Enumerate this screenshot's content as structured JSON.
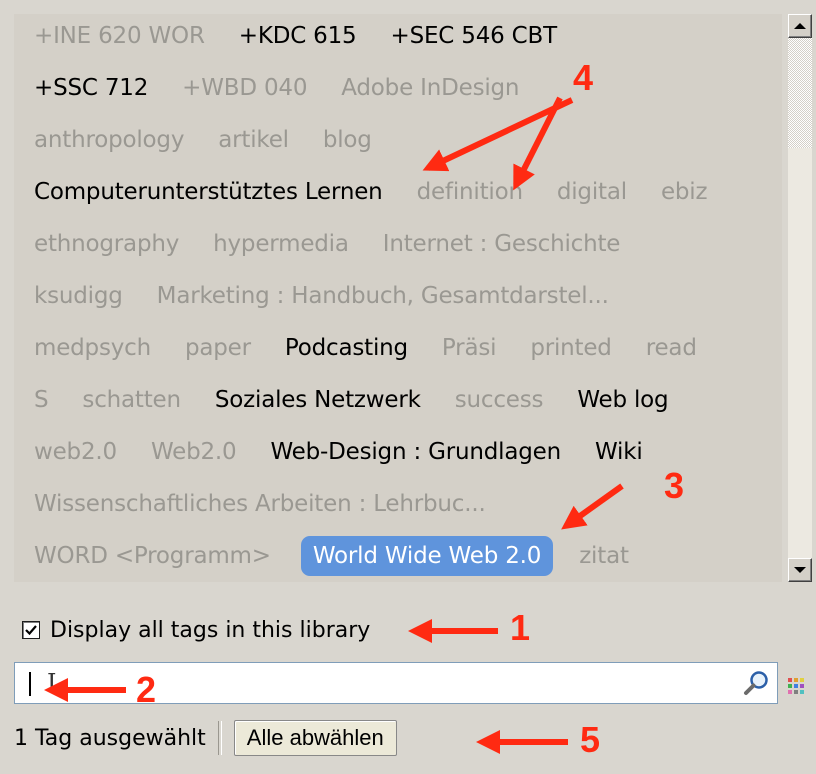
{
  "tags": {
    "rows": [
      [
        {
          "text": "+INE 620 WOR",
          "style": "dim"
        },
        {
          "text": "+KDC 615",
          "style": "bold"
        },
        {
          "text": "+SEC 546 CBT",
          "style": "bold"
        }
      ],
      [
        {
          "text": "+SSC 712",
          "style": "bold"
        },
        {
          "text": "+WBD 040",
          "style": "dim"
        },
        {
          "text": "Adobe InDesign",
          "style": "dim"
        }
      ],
      [
        {
          "text": "anthropology",
          "style": "dim"
        },
        {
          "text": "artikel",
          "style": "dim"
        },
        {
          "text": "blog",
          "style": "dim"
        }
      ],
      [
        {
          "text": "Computerunterstütztes Lernen",
          "style": "bold"
        },
        {
          "text": "definition",
          "style": "dim"
        },
        {
          "text": "digital",
          "style": "dim"
        },
        {
          "text": "ebiz",
          "style": "dim"
        }
      ],
      [
        {
          "text": "ethnography",
          "style": "dim"
        },
        {
          "text": "hypermedia",
          "style": "dim"
        },
        {
          "text": "Internet : Geschichte",
          "style": "dim"
        }
      ],
      [
        {
          "text": "ksudigg",
          "style": "dim"
        },
        {
          "text": "Marketing : Handbuch, Gesamtdarstel...",
          "style": "dim"
        }
      ],
      [
        {
          "text": "medpsych",
          "style": "dim"
        },
        {
          "text": "paper",
          "style": "dim"
        },
        {
          "text": "Podcasting",
          "style": "bold"
        },
        {
          "text": "Präsi",
          "style": "dim"
        },
        {
          "text": "printed",
          "style": "dim"
        },
        {
          "text": "read",
          "style": "dim"
        }
      ],
      [
        {
          "text": "S",
          "style": "dim"
        },
        {
          "text": "schatten",
          "style": "dim"
        },
        {
          "text": "Soziales Netzwerk",
          "style": "bold"
        },
        {
          "text": "success",
          "style": "dim"
        },
        {
          "text": "Web log",
          "style": "bold"
        }
      ],
      [
        {
          "text": "web2.0",
          "style": "dim"
        },
        {
          "text": "Web2.0",
          "style": "dim"
        },
        {
          "text": "Web-Design : Grundlagen",
          "style": "bold"
        },
        {
          "text": "Wiki",
          "style": "bold"
        }
      ],
      [
        {
          "text": "Wissenschaftliches Arbeiten : Lehrbuc...",
          "style": "dim"
        }
      ],
      [
        {
          "text": "WORD <Programm>",
          "style": "dim"
        },
        {
          "text": "World Wide Web 2.0",
          "style": "sel"
        },
        {
          "text": "zitat",
          "style": "dim"
        }
      ]
    ]
  },
  "display_all": {
    "label": "Display all tags in this library",
    "checked": true
  },
  "search": {
    "value": "",
    "placeholder": ""
  },
  "status": {
    "selected_text": "1 Tag ausgewählt",
    "deselect_label": "Alle abwählen"
  },
  "annotations": {
    "n1": "1",
    "n2": "2",
    "n3": "3",
    "n4": "4",
    "n5": "5"
  },
  "colors": {
    "accent": "#ff2a12",
    "selected_tag": "#5f94dc",
    "dim_text": "#9a9892"
  },
  "icons": {
    "search": "magnifier-icon",
    "color_picker": "color-grid-icon",
    "check": "checkmark-icon"
  }
}
